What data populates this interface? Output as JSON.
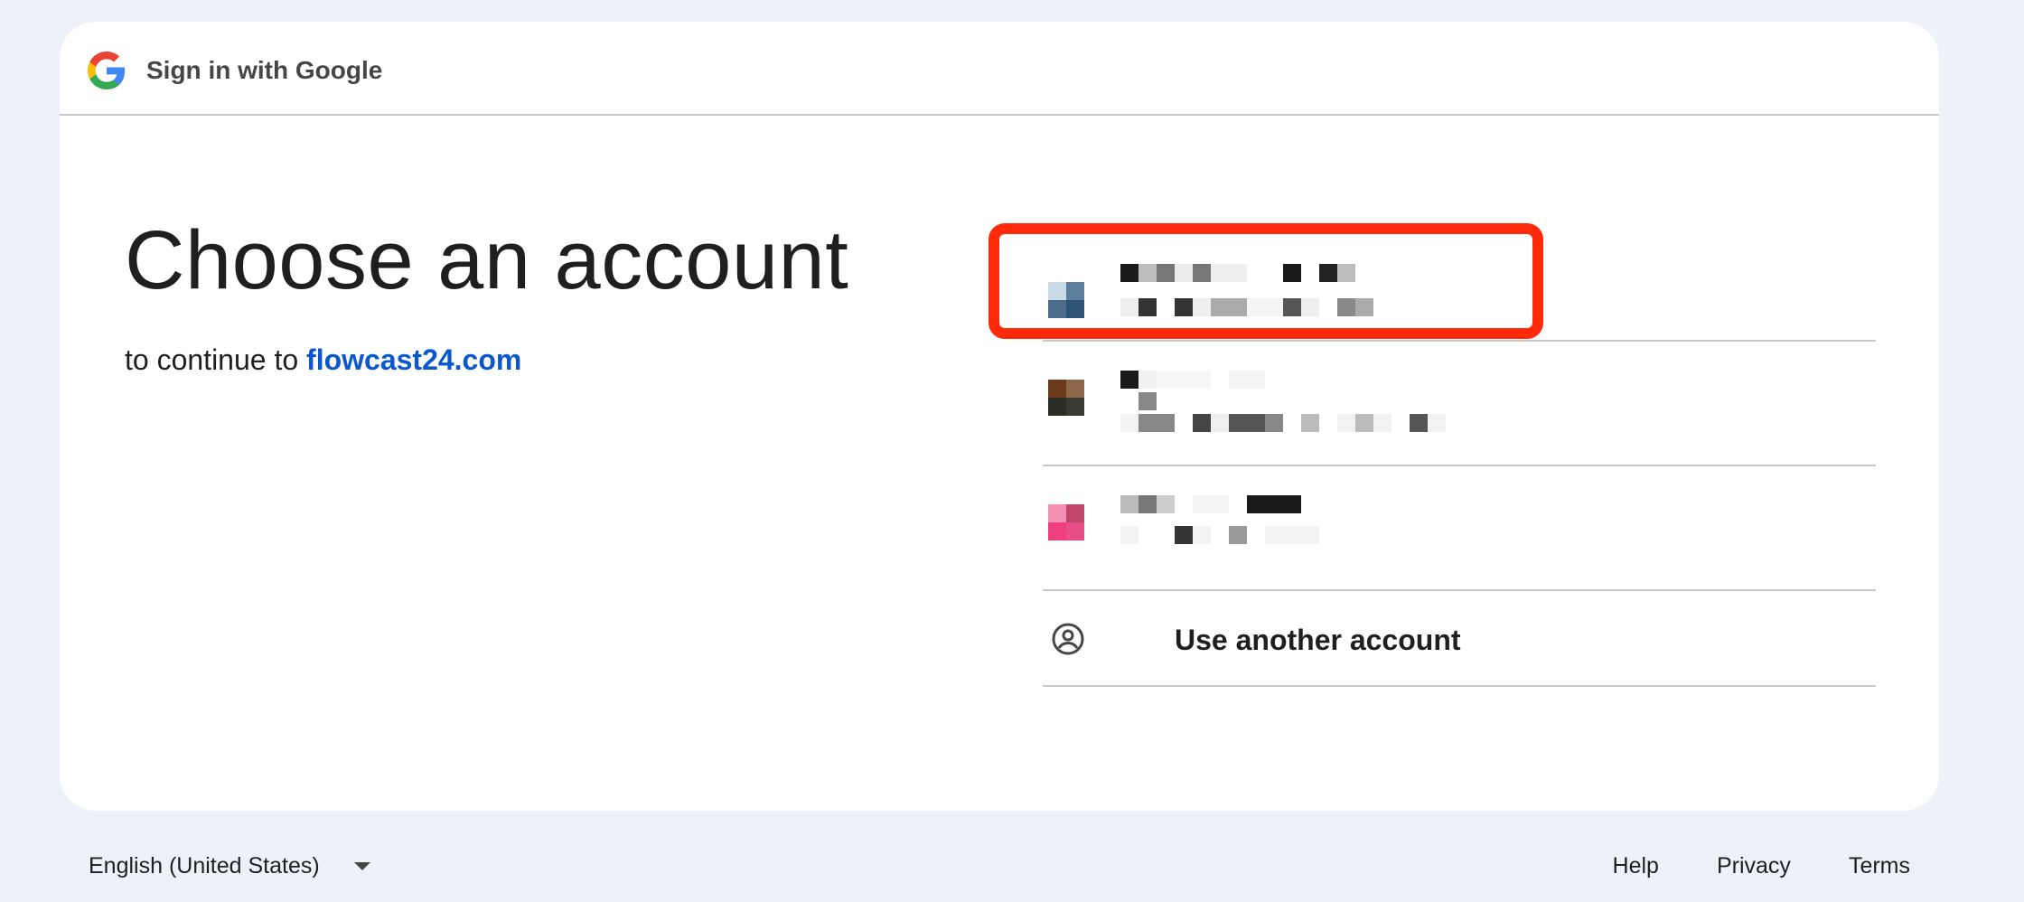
{
  "header": {
    "title": "Sign in with Google",
    "logo_icon": "google-g-icon"
  },
  "main": {
    "heading": "Choose an account",
    "subheading_prefix": "to continue to ",
    "site_link": "flowcast24.com"
  },
  "accounts": [
    {
      "name": "",
      "email": "",
      "state": "blurred",
      "highlighted": true
    },
    {
      "name": "",
      "email": "",
      "state": "blurred",
      "highlighted": false
    },
    {
      "name": "",
      "email": "",
      "state": "blurred",
      "highlighted": false
    }
  ],
  "use_another": {
    "label": "Use another account",
    "icon": "person-circle-icon"
  },
  "footer": {
    "language": "English (United States)",
    "links": [
      "Help",
      "Privacy",
      "Terms"
    ]
  },
  "colors": {
    "background": "#eef1f8",
    "link": "#0b57d0",
    "highlight_border": "#ff2a0a"
  }
}
